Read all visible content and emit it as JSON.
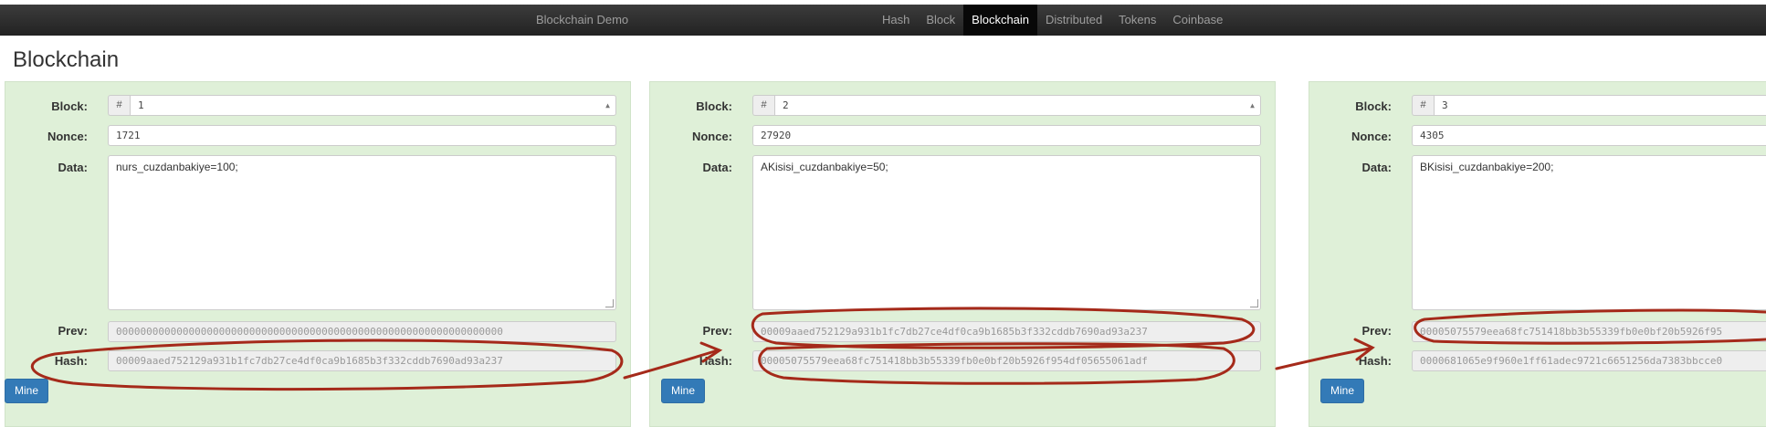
{
  "navbar": {
    "brand": "Blockchain Demo",
    "links": [
      "Hash",
      "Block",
      "Blockchain",
      "Distributed",
      "Tokens",
      "Coinbase"
    ],
    "active": "Blockchain"
  },
  "page_title": "Blockchain",
  "labels": {
    "block": "Block:",
    "nonce": "Nonce:",
    "data": "Data:",
    "prev": "Prev:",
    "hash": "Hash:",
    "mine": "Mine",
    "hash_addon": "#"
  },
  "blocks": [
    {
      "number": "1",
      "nonce": "1721",
      "data": "nurs_cuzdanbakiye=100;",
      "prev": "0000000000000000000000000000000000000000000000000000000000000000",
      "hash": "00009aaed752129a931b1fc7db27ce4df0ca9b1685b3f332cddb7690ad93a237"
    },
    {
      "number": "2",
      "nonce": "27920",
      "data": "AKisisi_cuzdanbakiye=50;",
      "prev": "00009aaed752129a931b1fc7db27ce4df0ca9b1685b3f332cddb7690ad93a237",
      "hash": "00005075579eea68fc751418bb3b55339fb0e0bf20b5926f954df05655061adf"
    },
    {
      "number": "3",
      "nonce": "4305",
      "data": "BKisisi_cuzdanbakiye=200;",
      "prev": "00005075579eea68fc751418bb3b55339fb0e0bf20b5926f95",
      "hash": "0000681065e9f960e1ff61adec9721c6651256da7383bbcce0"
    }
  ],
  "annotation_color": "#a52a1a"
}
